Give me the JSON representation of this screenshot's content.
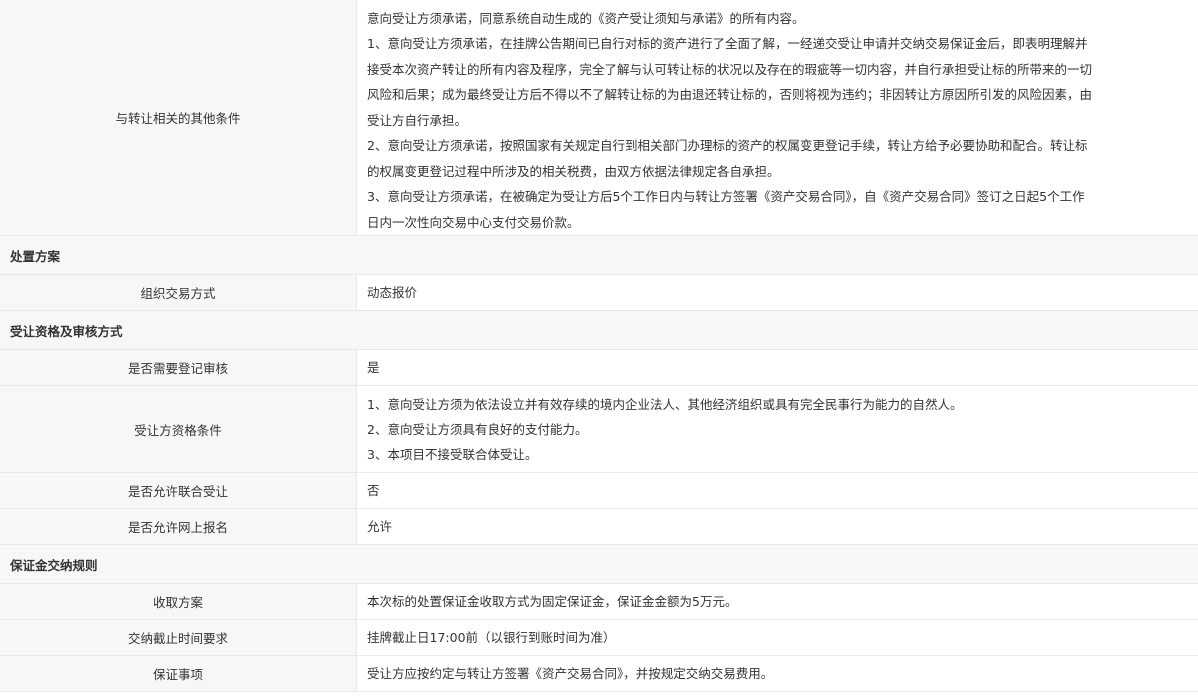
{
  "other_conditions": {
    "label": "与转让相关的其他条件",
    "lines": [
      "意向受让方须承诺，同意系统自动生成的《资产受让须知与承诺》的所有内容。",
      "1、意向受让方须承诺，在挂牌公告期间已自行对标的资产进行了全面了解，一经递交受让申请并交纳交易保证金后，即表明理解并",
      "接受本次资产转让的所有内容及程序，完全了解与认可转让标的状况以及存在的瑕疵等一切内容，并自行承担受让标的所带来的一切",
      "风险和后果；成为最终受让方后不得以不了解转让标的为由退还转让标的，否则将视为违约；非因转让方原因所引发的风险因素，由",
      "受让方自行承担。",
      "2、意向受让方须承诺，按照国家有关规定自行到相关部门办理标的资产的权属变更登记手续，转让方给予必要协助和配合。转让标",
      "的权属变更登记过程中所涉及的相关税费，由双方依据法律规定各自承担。",
      "3、意向受让方须承诺，在被确定为受让方后5个工作日内与转让方签署《资产交易合同》，自《资产交易合同》签订之日起5个工作",
      "日内一次性向交易中心支付交易价款。"
    ]
  },
  "disposal": {
    "section_title": "处置方案",
    "method_label": "组织交易方式",
    "method_value": "动态报价"
  },
  "qualification": {
    "section_title": "受让资格及审核方式",
    "register_review_label": "是否需要登记审核",
    "register_review_value": "是",
    "conditions_label": "受让方资格条件",
    "conditions_lines": [
      "1、意向受让方须为依法设立并有效存续的境内企业法人、其他经济组织或具有完全民事行为能力的自然人。",
      "2、意向受让方须具有良好的支付能力。",
      "3、本项目不接受联合体受让。"
    ],
    "joint_label": "是否允许联合受让",
    "joint_value": "否",
    "online_label": "是否允许网上报名",
    "online_value": "允许"
  },
  "deposit": {
    "section_title": "保证金交纳规则",
    "scheme_label": "收取方案",
    "scheme_value": "本次标的处置保证金收取方式为固定保证金，保证金金额为5万元。",
    "deadline_label": "交纳截止时间要求",
    "deadline_value": "挂牌截止日17:00前（以银行到账时间为准）",
    "notes_label": "保证事项",
    "notes_value": "受让方应按约定与转让方签署《资产交易合同》，并按规定交纳交易费用。"
  }
}
